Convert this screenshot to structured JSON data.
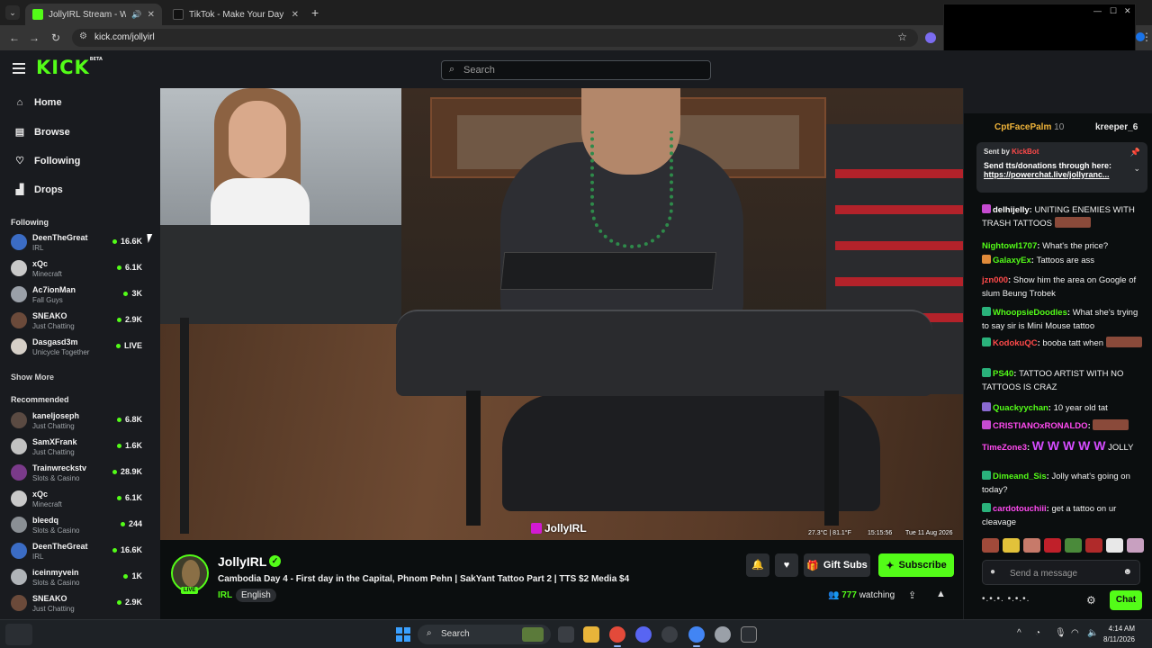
{
  "browser": {
    "tabs": [
      {
        "title": "JollyIRL Stream - Watch Live",
        "favicon_color": "#53fc18",
        "active": true
      },
      {
        "title": "TikTok - Make Your Day",
        "favicon_color": "#111111",
        "active": false
      }
    ],
    "new_tab": "+",
    "url": "kick.com/jollyirl"
  },
  "header": {
    "logo": "KICK",
    "logo_badge": "BETA",
    "search_placeholder": "Search"
  },
  "sidebar": {
    "nav": [
      {
        "label": "Home",
        "icon": "home-icon",
        "glyph": "⌂"
      },
      {
        "label": "Browse",
        "icon": "browse-icon",
        "glyph": "▤"
      },
      {
        "label": "Following",
        "icon": "heart-icon",
        "glyph": "♡"
      },
      {
        "label": "Drops",
        "icon": "drops-icon",
        "glyph": "▟"
      }
    ],
    "following_heading": "Following",
    "following": [
      {
        "name": "DeenTheGreat",
        "category": "IRL",
        "viewers": "16.6K",
        "color": "#3b6cc4"
      },
      {
        "name": "xQc",
        "category": "Minecraft",
        "viewers": "6.1K",
        "color": "#c9c9c9"
      },
      {
        "name": "Ac7ionMan",
        "category": "Fall Guys",
        "viewers": "3K",
        "color": "#9aa0a8"
      },
      {
        "name": "SNEAKO",
        "category": "Just Chatting",
        "viewers": "2.9K",
        "color": "#6b4a3a"
      },
      {
        "name": "Dasgasd3m",
        "category": "Unicycle Together",
        "viewers": "LIVE",
        "color": "#d6d0c8"
      }
    ],
    "show_more": "Show More",
    "recommended_heading": "Recommended",
    "recommended": [
      {
        "name": "kaneljoseph",
        "category": "Just Chatting",
        "viewers": "6.8K",
        "color": "#5a4a42"
      },
      {
        "name": "SamXFrank",
        "category": "Just Chatting",
        "viewers": "1.6K",
        "color": "#c2c2c2"
      },
      {
        "name": "Trainwreckstv",
        "category": "Slots & Casino",
        "viewers": "28.9K",
        "color": "#7a3a8a"
      },
      {
        "name": "xQc",
        "category": "Minecraft",
        "viewers": "6.1K",
        "color": "#c9c9c9"
      },
      {
        "name": "bleedq",
        "category": "Slots & Casino",
        "viewers": "244",
        "color": "#8a8f94"
      },
      {
        "name": "DeenTheGreat",
        "category": "IRL",
        "viewers": "16.6K",
        "color": "#3b6cc4"
      },
      {
        "name": "iceinmyvein",
        "category": "Slots & Casino",
        "viewers": "1K",
        "color": "#b0b4b8"
      },
      {
        "name": "SNEAKO",
        "category": "Just Chatting",
        "viewers": "2.9K",
        "color": "#6b4a3a"
      }
    ]
  },
  "video": {
    "watermark": "JollyIRL",
    "temperature": "27.3°C | 81.1°F",
    "time": "15:15:56",
    "date": "Tue 11 Aug 2026"
  },
  "stream": {
    "channel": "JollyIRL",
    "live_label": "LIVE",
    "title": "Cambodia Day 4 - First day in the Capital, Phnom Pehn | SakYant Tattoo Part 2 | TTS $2 Media $4",
    "category": "IRL",
    "language": "English",
    "gift_subs": "Gift Subs",
    "subscribe": "Subscribe",
    "viewers": "777",
    "watching_label": "watching"
  },
  "chat": {
    "top_gifters": [
      {
        "name": "CptFacePalm",
        "count": "10",
        "color": "#f0b43a"
      },
      {
        "name": "kreeper_6",
        "count": "",
        "color": "#e8e8e8"
      }
    ],
    "pinned": {
      "sent_by": "Sent by",
      "sender": "KickBot",
      "message": "Send tts/donations through here:",
      "link": "https://powerchat.live/jollyranc..."
    },
    "messages": [
      {
        "user": "delhijelly",
        "color": "#ffffff",
        "text": "UNITING ENEMIES WITH TRASH TATTOOS",
        "badge": "#c64bd1",
        "emote": true
      },
      {
        "user": "Nightowl1707",
        "color": "#53fc18",
        "text": "What's the price?",
        "badge": "",
        "emote": false
      },
      {
        "user": "GalaxyEx",
        "color": "#53fc18",
        "text": "Tattoos are ass",
        "badge": "#e08a3a",
        "emote": false
      },
      {
        "user": "jzn000",
        "color": "#ff4a4a",
        "text": "Show him the area on Google of slum Beung Trobek",
        "badge": "",
        "emote": false
      },
      {
        "user": "WhoopsieDoodles",
        "color": "#53fc18",
        "text": "What she's trying to say sir is Mini Mouse tattoo",
        "badge": "#2ab27b",
        "emote": false
      },
      {
        "user": "KodokuQC",
        "color": "#ff4a4a",
        "text": "booba tatt when",
        "badge": "#2ab27b",
        "emote": true
      },
      {
        "user": "PS40",
        "color": "#53fc18",
        "text": "TATTOO ARTIST WITH NO TATTOOS IS CRAZ",
        "badge": "#2ab27b",
        "emote": false
      },
      {
        "user": "Quackyychan",
        "color": "#53fc18",
        "text": "10 year old tat",
        "badge": "#8a6ad1",
        "emote": false
      },
      {
        "user": "CRISTIANOxRONALDO",
        "color": "#ff4af0",
        "text": "",
        "badge": "#c64bd1",
        "emote": true
      },
      {
        "user": "TimeZone3",
        "color": "#ff4af0",
        "text": "JOLLY",
        "badge": "",
        "emote": false,
        "w": "W W W W W"
      },
      {
        "user": "Dimeand_Sis",
        "color": "#53fc18",
        "text": "Jolly what's going on today?",
        "badge": "#2ab27b",
        "emote": false
      },
      {
        "user": "cardotouchiii",
        "color": "#ff4af0",
        "text": "get a tattoo on ur cleavage",
        "badge": "#2ab27b",
        "emote": false
      }
    ],
    "input_placeholder": "Send a message",
    "chat_button": "Chat",
    "footer_text": "•.•.•. •.•.•."
  },
  "taskbar": {
    "search_label": "Search",
    "time": "4:14 AM",
    "date": "8/11/2026"
  }
}
